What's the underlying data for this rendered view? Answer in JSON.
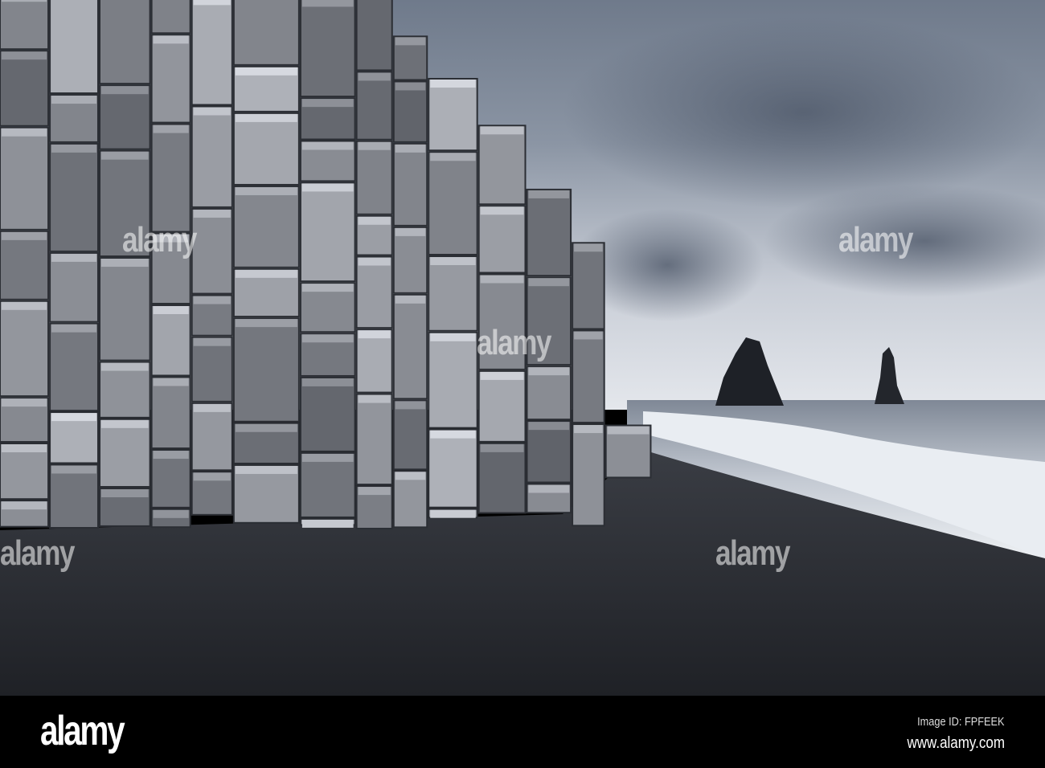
{
  "photo": {
    "subject": "Basalt columns and sea stacks on black sand beach",
    "watermark_text": "alamy"
  },
  "footer": {
    "logo": "alamy",
    "image_id": "Image ID: FPFEEK",
    "website": "www.alamy.com"
  },
  "colors": {
    "sky_top": "#6d7889",
    "sky_bottom": "#dfe3ea",
    "sea": "#9aa3b0",
    "surf": "#e8ecf1",
    "sand": "#2a2c31",
    "rock": "#7d828b"
  }
}
